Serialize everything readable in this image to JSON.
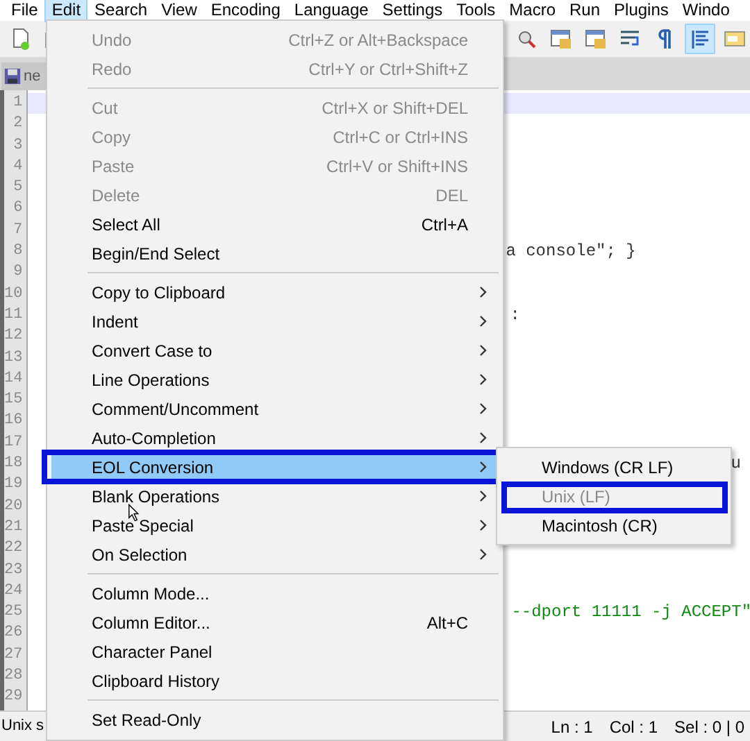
{
  "menubar": [
    {
      "label": "File",
      "selected": false
    },
    {
      "label": "Edit",
      "selected": true
    },
    {
      "label": "Search",
      "selected": false
    },
    {
      "label": "View",
      "selected": false
    },
    {
      "label": "Encoding",
      "selected": false
    },
    {
      "label": "Language",
      "selected": false
    },
    {
      "label": "Settings",
      "selected": false
    },
    {
      "label": "Tools",
      "selected": false
    },
    {
      "label": "Macro",
      "selected": false
    },
    {
      "label": "Run",
      "selected": false
    },
    {
      "label": "Plugins",
      "selected": false
    },
    {
      "label": "Windo",
      "selected": false
    }
  ],
  "toolbar": [
    {
      "kind": "new-file",
      "pressed": false
    },
    {
      "kind": "folder",
      "pressed": false
    },
    {
      "kind": "find",
      "pressed": false
    },
    {
      "kind": "window",
      "pressed": false
    },
    {
      "kind": "window",
      "pressed": false
    },
    {
      "kind": "wrap",
      "pressed": false
    },
    {
      "kind": "pilcrow",
      "pressed": false
    },
    {
      "kind": "indent",
      "pressed": true
    },
    {
      "kind": "panel",
      "pressed": false
    }
  ],
  "tab": {
    "label": "ne"
  },
  "editor": {
    "lines": [
      {
        "number": "1",
        "current": true
      },
      {
        "number": "2",
        "current": false
      },
      {
        "number": "3",
        "current": false
      },
      {
        "number": "4",
        "current": false
      },
      {
        "number": "5",
        "current": false
      },
      {
        "number": "6",
        "current": false
      },
      {
        "number": "7",
        "current": false
      },
      {
        "number": "8",
        "current": false,
        "text": "a console\"; }",
        "kind": "plain"
      },
      {
        "number": "9",
        "current": false
      },
      {
        "number": "10",
        "current": false
      },
      {
        "number": "11",
        "current": false,
        "text": ":",
        "kind": "plain"
      },
      {
        "number": "12",
        "current": false
      },
      {
        "number": "13",
        "current": false
      },
      {
        "number": "14",
        "current": false
      },
      {
        "number": "15",
        "current": false
      },
      {
        "number": "16",
        "current": false
      },
      {
        "number": "17",
        "current": false
      },
      {
        "number": "18",
        "current": false,
        "text": "u",
        "kind": "plain"
      },
      {
        "number": "19",
        "current": false
      },
      {
        "number": "20",
        "current": false
      },
      {
        "number": "21",
        "current": false
      },
      {
        "number": "22",
        "current": false
      },
      {
        "number": "23",
        "current": false
      },
      {
        "number": "24",
        "current": false
      },
      {
        "number": "25",
        "current": false,
        "text": "--dport 11111 -j ACCEPT\"",
        "kind": "string"
      },
      {
        "number": "26",
        "current": false
      },
      {
        "number": "27",
        "current": false
      },
      {
        "number": "28",
        "current": false
      },
      {
        "number": "29",
        "current": false
      }
    ]
  },
  "status_bar": {
    "left": "Unix s",
    "ln": "Ln : 1",
    "col": "Col : 1",
    "sel": "Sel : 0 | 0"
  },
  "edit_menu": [
    {
      "kind": "item",
      "label": "Undo",
      "shortcut": "Ctrl+Z or Alt+Backspace",
      "disabled": true,
      "submenu": false,
      "selected": false,
      "outlined": false
    },
    {
      "kind": "item",
      "label": "Redo",
      "shortcut": "Ctrl+Y or Ctrl+Shift+Z",
      "disabled": true,
      "submenu": false,
      "selected": false,
      "outlined": false
    },
    {
      "kind": "separator"
    },
    {
      "kind": "item",
      "label": "Cut",
      "shortcut": "Ctrl+X or Shift+DEL",
      "disabled": true,
      "submenu": false,
      "selected": false,
      "outlined": false
    },
    {
      "kind": "item",
      "label": "Copy",
      "shortcut": "Ctrl+C or Ctrl+INS",
      "disabled": true,
      "submenu": false,
      "selected": false,
      "outlined": false
    },
    {
      "kind": "item",
      "label": "Paste",
      "shortcut": "Ctrl+V or Shift+INS",
      "disabled": true,
      "submenu": false,
      "selected": false,
      "outlined": false
    },
    {
      "kind": "item",
      "label": "Delete",
      "shortcut": "DEL",
      "disabled": true,
      "submenu": false,
      "selected": false,
      "outlined": false
    },
    {
      "kind": "item",
      "label": "Select All",
      "shortcut": "Ctrl+A",
      "disabled": false,
      "submenu": false,
      "selected": false,
      "outlined": false
    },
    {
      "kind": "item",
      "label": "Begin/End Select",
      "disabled": false,
      "submenu": false,
      "selected": false,
      "outlined": false
    },
    {
      "kind": "separator"
    },
    {
      "kind": "item",
      "label": "Copy to Clipboard",
      "disabled": false,
      "submenu": true,
      "selected": false,
      "outlined": false
    },
    {
      "kind": "item",
      "label": "Indent",
      "disabled": false,
      "submenu": true,
      "selected": false,
      "outlined": false
    },
    {
      "kind": "item",
      "label": "Convert Case to",
      "disabled": false,
      "submenu": true,
      "selected": false,
      "outlined": false
    },
    {
      "kind": "item",
      "label": "Line Operations",
      "disabled": false,
      "submenu": true,
      "selected": false,
      "outlined": false
    },
    {
      "kind": "item",
      "label": "Comment/Uncomment",
      "disabled": false,
      "submenu": true,
      "selected": false,
      "outlined": false
    },
    {
      "kind": "item",
      "label": "Auto-Completion",
      "disabled": false,
      "submenu": true,
      "selected": false,
      "outlined": false
    },
    {
      "kind": "item",
      "label": "EOL Conversion",
      "disabled": false,
      "submenu": true,
      "selected": true,
      "outlined": true
    },
    {
      "kind": "item",
      "label": "Blank Operations",
      "disabled": false,
      "submenu": true,
      "selected": false,
      "outlined": false
    },
    {
      "kind": "item",
      "label": "Paste Special",
      "disabled": false,
      "submenu": true,
      "selected": false,
      "outlined": false
    },
    {
      "kind": "item",
      "label": "On Selection",
      "disabled": false,
      "submenu": true,
      "selected": false,
      "outlined": false
    },
    {
      "kind": "separator"
    },
    {
      "kind": "item",
      "label": "Column Mode...",
      "disabled": false,
      "submenu": false,
      "selected": false,
      "outlined": false
    },
    {
      "kind": "item",
      "label": "Column Editor...",
      "shortcut": "Alt+C",
      "disabled": false,
      "submenu": false,
      "selected": false,
      "outlined": false
    },
    {
      "kind": "item",
      "label": "Character Panel",
      "disabled": false,
      "submenu": false,
      "selected": false,
      "outlined": false
    },
    {
      "kind": "item",
      "label": "Clipboard History",
      "disabled": false,
      "submenu": false,
      "selected": false,
      "outlined": false
    },
    {
      "kind": "separator"
    },
    {
      "kind": "item",
      "label": "Set Read-Only",
      "disabled": false,
      "submenu": false,
      "selected": false,
      "outlined": false
    }
  ],
  "eol_submenu": [
    {
      "label": "Windows (CR LF)",
      "disabled": false,
      "outlined": false
    },
    {
      "label": "Unix (LF)",
      "disabled": true,
      "outlined": true
    },
    {
      "label": "Macintosh (CR)",
      "disabled": false,
      "outlined": false
    }
  ]
}
